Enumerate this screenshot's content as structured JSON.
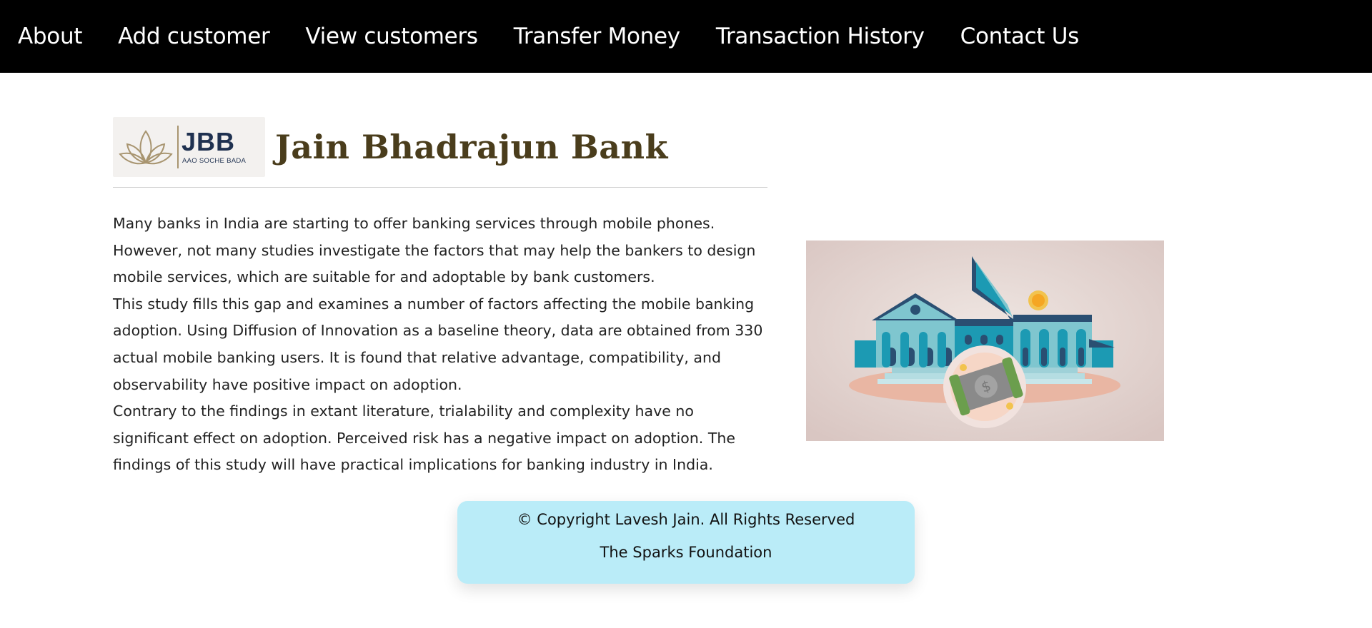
{
  "nav": {
    "items": [
      {
        "label": "About"
      },
      {
        "label": "Add customer"
      },
      {
        "label": "View customers"
      },
      {
        "label": "Transfer Money"
      },
      {
        "label": "Transaction History"
      },
      {
        "label": "Contact Us"
      }
    ]
  },
  "brand": {
    "logo_abbr": "JBB",
    "logo_tagline": "AAO SOCHE BADA",
    "title": "Jain Bhadrajun Bank"
  },
  "content": {
    "paragraphs": [
      "Many banks in India are starting to offer banking services through mobile phones. However, not many studies investigate the factors that may help the bankers to design mobile services, which are suitable for and adoptable by bank customers.",
      "This study fills this gap and examines a number of factors affecting the mobile banking adoption. Using Diffusion of Innovation as a baseline theory, data are obtained from 330 actual mobile banking users. It is found that relative advantage, compatibility, and observability have positive impact on adoption.",
      "Contrary to the findings in extant literature, trialability and complexity have no significant effect on adoption. Perceived risk has a negative impact on adoption. The findings of this study will have practical implications for banking industry in India."
    ]
  },
  "footer": {
    "copyright": "© Copyright Lavesh Jain. All Rights Reserved",
    "organization": "The Sparks Foundation"
  },
  "colors": {
    "nav_bg": "#000000",
    "title": "#4a3d1c",
    "logo_navy": "#1f3150",
    "logo_gold": "#a89570",
    "footer_bg": "#baecf8"
  }
}
